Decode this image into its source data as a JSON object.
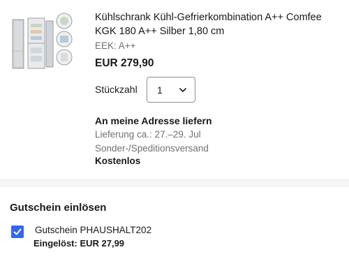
{
  "item": {
    "image_icon": "fridge-freezer-product-photo",
    "title": "Kühlschrank Kühl-Gefrierkombination A++ Comfee KGK 180 A++ Silber 1,80 cm",
    "energy_class": "EEK: A++",
    "price": "EUR 279,90"
  },
  "quantity": {
    "label": "Stückzahl",
    "value": "1",
    "icon": "chevron-down-icon"
  },
  "shipping": {
    "title": "An meine Adresse liefern",
    "delivery_estimate": "Lieferung ca.: 27.–29. Jul",
    "method": "Sonder-/Speditionsversand",
    "cost": "Kostenlos"
  },
  "coupon": {
    "heading": "Gutschein einlösen",
    "checked": true,
    "code_text": "Gutschein PHAUSHALT202",
    "redeemed_text": "Eingelöst: EUR 27,99"
  },
  "colors": {
    "accent": "#3665f3",
    "text": "#191919",
    "secondary_text": "#707070",
    "divider": "#f5f5f5"
  }
}
